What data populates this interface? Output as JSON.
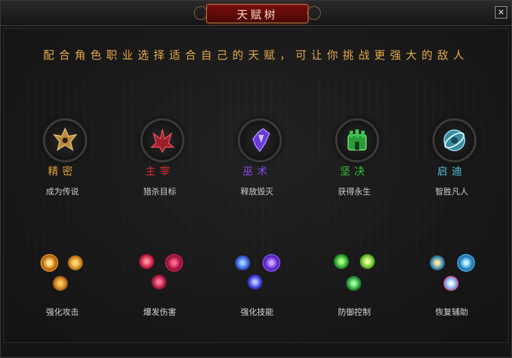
{
  "window": {
    "title": "天赋树",
    "close_label": "✕"
  },
  "subtitle": "配合角色职业选择适合自己的天赋，可让你挑战更强大的敌人",
  "talents": [
    {
      "name": "精密",
      "desc": "成为传说",
      "skill_label": "强化攻击",
      "color": "#e0a23a",
      "icon": "spiked-crest-icon"
    },
    {
      "name": "主宰",
      "desc": "猎杀目标",
      "skill_label": "爆发伤害",
      "color": "#e0302e",
      "icon": "claw-crest-icon"
    },
    {
      "name": "巫术",
      "desc": "释放毁灭",
      "skill_label": "强化技能",
      "color": "#8a4cf0",
      "icon": "crystal-crest-icon"
    },
    {
      "name": "坚决",
      "desc": "获得永生",
      "skill_label": "防御控制",
      "color": "#39c23a",
      "icon": "fortress-crest-icon"
    },
    {
      "name": "启迪",
      "desc": "智胜凡人",
      "skill_label": "恢复辅助",
      "color": "#58c8e0",
      "icon": "orbit-crest-icon"
    }
  ]
}
